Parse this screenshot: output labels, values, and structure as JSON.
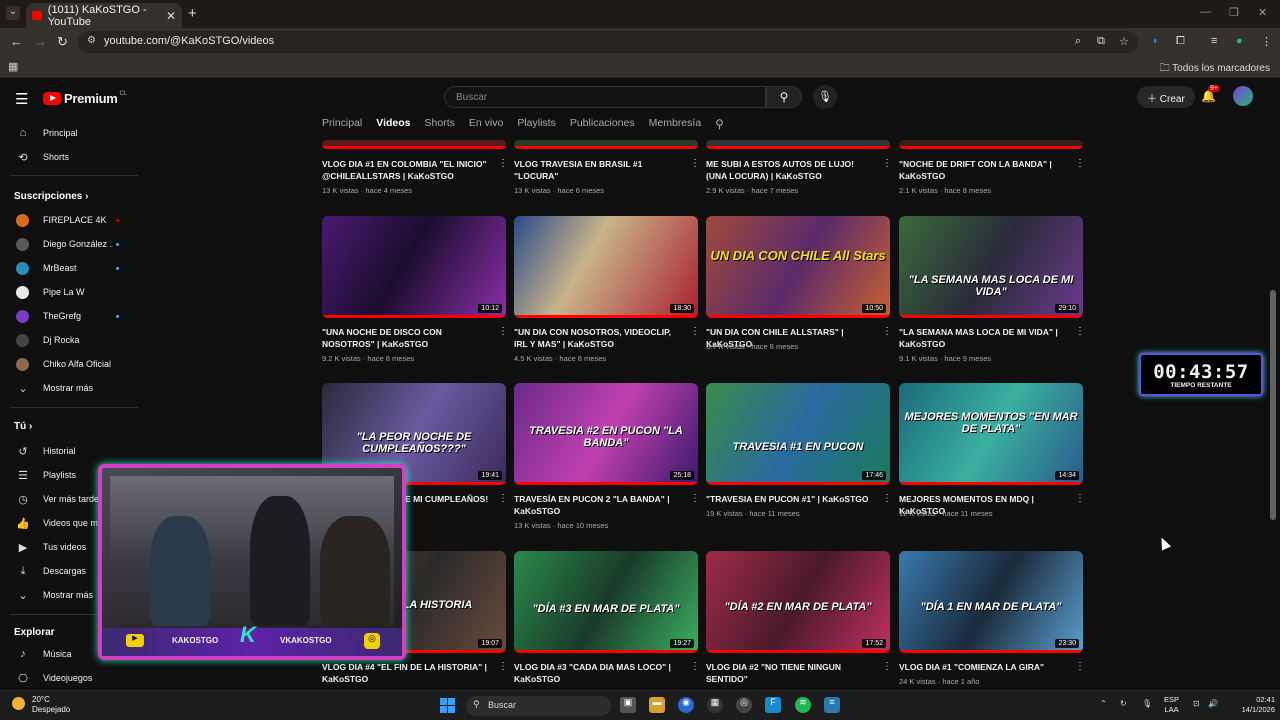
{
  "browser": {
    "tab_title": "(1011) KaKoSTGO - YouTube",
    "url": "youtube.com/@KaKoSTGO/videos",
    "bookmarks_all": "Todos los marcadores"
  },
  "masthead": {
    "logo_text": "Premium",
    "logo_cc": "CL",
    "search_placeholder": "Buscar",
    "create_label": "Crear",
    "notif_count": "9+"
  },
  "channel_tabs": [
    "Principal",
    "Videos",
    "Shorts",
    "En vivo",
    "Playlists",
    "Publicaciones",
    "Membresía"
  ],
  "sidebar": {
    "main": [
      {
        "label": "Principal",
        "icon": "home-icon"
      },
      {
        "label": "Shorts",
        "icon": "shorts-icon"
      }
    ],
    "subs_title": "Suscripciones",
    "subs": [
      {
        "label": "FIREPLACE 4K",
        "color": "#d96b1c"
      },
      {
        "label": "Diego González ...",
        "color": "#585858"
      },
      {
        "label": "MrBeast",
        "color": "#2a8db8"
      },
      {
        "label": "Pipe La W",
        "color": "#e8e8e8"
      },
      {
        "label": "TheGrefg",
        "color": "#7b3cc8"
      },
      {
        "label": "Dj Rocka",
        "color": "#444"
      },
      {
        "label": "Chiko Alfa Oficial",
        "color": "#8a6a4e"
      }
    ],
    "more1": "Mostrar más",
    "you_title": "Tú",
    "you": [
      {
        "label": "Historial",
        "icon": "history-icon"
      },
      {
        "label": "Playlists",
        "icon": "playlist-icon"
      },
      {
        "label": "Ver más tarde",
        "icon": "clock-icon"
      },
      {
        "label": "Videos que me",
        "icon": "thumbs-up-icon"
      },
      {
        "label": "Tus videos",
        "icon": "video-icon"
      },
      {
        "label": "Descargas",
        "icon": "download-icon"
      }
    ],
    "more2": "Mostrar más",
    "explore_title": "Explorar",
    "explore": [
      {
        "label": "Música",
        "icon": "music-icon"
      },
      {
        "label": "Videojuegos",
        "icon": "gamepad-icon"
      }
    ]
  },
  "videos_row0": [
    {
      "title": "VLOG DIA #1 EN COLOMBIA \"EL INICIO\" @CHILEALLSTARS | KaKoSTGO",
      "meta": "13 K vistas · hace 4 meses"
    },
    {
      "title": "VLOG TRAVESIA EN BRASIL #1 \"LOCURA\"",
      "meta": "13 K vistas · hace 6 meses"
    },
    {
      "title": "ME SUBI A ESTOS AUTOS DE LUJO! (UNA LOCURA) | KaKoSTGO",
      "meta": "2.9 K vistas · hace 7 meses"
    },
    {
      "title": "\"NOCHE DE DRIFT CON LA BANDA\" | KaKoSTGO",
      "meta": "2.1 K vistas · hace 8 meses"
    }
  ],
  "videos_row1": [
    {
      "title": "\"UNA NOCHE DE DISCO CON NOSOTROS\" | KaKoSTGO",
      "meta": "9.2 K vistas · hace 8 meses",
      "dur": "10:12",
      "overlay": ""
    },
    {
      "title": "\"UN DIA CON NOSOTROS, VIDEOCLIP, IRL Y MAS\" | KaKoSTGO",
      "meta": "4.5 K vistas · hace 8 meses",
      "dur": "18:30",
      "overlay": ""
    },
    {
      "title": "\"UN DIA CON CHILE ALLSTARS\" | KaKoSTGO",
      "meta": "3.7 K vistas · hace 8 meses",
      "dur": "10:50",
      "overlay": "UN DIA CON CHILE All Stars"
    },
    {
      "title": "\"LA SEMANA MAS LOCA DE MI VIDA\" | KaKoSTGO",
      "meta": "9.1 K vistas · hace 9 meses",
      "dur": "29:10",
      "overlay": "\"LA SEMANA MAS LOCA DE MI VIDA\""
    }
  ],
  "videos_row2": [
    {
      "title": "\"LA PEOR NOCHE DE MI CUMPLEAÑOS! | KaKoSTGO",
      "meta": "",
      "dur": "19:41",
      "overlay": "\"LA PEOR NOCHE DE CUMPLEAÑOS???\""
    },
    {
      "title": "TRAVESÍA EN PUCON 2 \"LA BANDA\" | KaKoSTGO",
      "meta": "13 K vistas · hace 10 meses",
      "dur": "25:18",
      "overlay": "TRAVESIA #2 EN PUCON \"LA BANDA\""
    },
    {
      "title": "\"TRAVESIA EN PUCON #1\" | KaKoSTGO",
      "meta": "19 K vistas · hace 11 meses",
      "dur": "17:46",
      "overlay": "TRAVESIA #1 EN PUCON"
    },
    {
      "title": "MEJORES MOMENTOS EN MDQ | KaKoSTGO",
      "meta": "12 K vistas · hace 11 meses",
      "dur": "14:34",
      "overlay": "MEJORES MOMENTOS \"EN MAR DE PLATA\""
    }
  ],
  "videos_row3": [
    {
      "title": "VLOG DIA #4 \"EL FIN DE LA HISTORIA\" | KaKoSTGO",
      "meta": "",
      "dur": "19:07",
      "overlay": "EN MDQ LA HISTORIA"
    },
    {
      "title": "VLOG DIA #3 \"CADA DIA MAS LOCO\" | KaKoSTGO",
      "meta": "",
      "dur": "19:27",
      "overlay": "\"DÍA #3 EN MAR DE PLATA\""
    },
    {
      "title": "VLOG DIA #2 \"NO TIENE NINGUN SENTIDO\"",
      "meta": "",
      "dur": "17:52",
      "overlay": "\"DÍA #2 EN MAR DE PLATA\""
    },
    {
      "title": "VLOG DIA #1 \"COMIENZA LA GIRA\"",
      "meta": "24 K vistas · hace 1 año",
      "dur": "23:30",
      "overlay": "\"DÍA 1 EN MAR DE PLATA\""
    }
  ],
  "timer": {
    "time": "00:43:57",
    "label": "TIEMPO RESTANTE"
  },
  "cam": {
    "name1": "KAKOSTGO",
    "name2": "VKAKOSTGO"
  },
  "taskbar": {
    "temp": "20°C",
    "weather": "Despejado",
    "search": "Buscar",
    "lang1": "ESP",
    "lang2": "LAA",
    "time": "02:41",
    "date": "14/1/2026"
  }
}
